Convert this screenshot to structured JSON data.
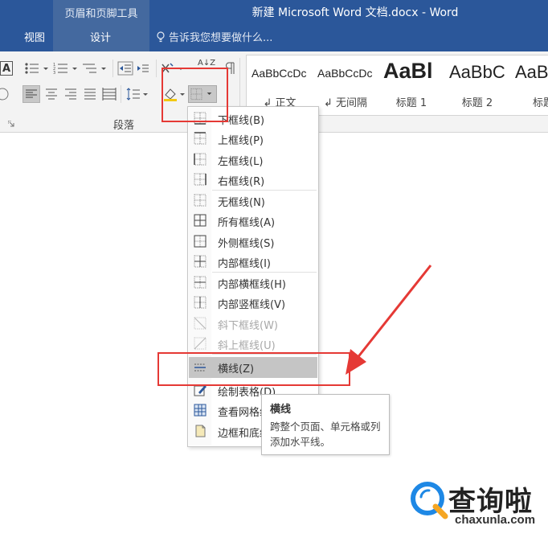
{
  "titlebar": {
    "context_group": "页眉和页脚工具",
    "doc_title": "新建 Microsoft Word 文档.docx - Word",
    "tabs": [
      {
        "label": "视图"
      },
      {
        "label": "设计"
      }
    ],
    "tell_me": "告诉我您想要做什么..."
  },
  "ribbon": {
    "group_label": "段落",
    "font_box_label": "A",
    "sort_label": "A↓Z",
    "styles": [
      {
        "sample": "AaBbCcDc",
        "name": "↲ 正文"
      },
      {
        "sample": "AaBbCcDc",
        "name": "↲ 无间隔"
      },
      {
        "sample": "AaBl",
        "name": "标题 1"
      },
      {
        "sample": "AaBbC",
        "name": "标题 2"
      },
      {
        "sample": "AaB",
        "name": "标题"
      }
    ]
  },
  "menu": {
    "items": [
      {
        "label": "下框线(B)",
        "icon": "border-bottom-icon",
        "disabled": false
      },
      {
        "label": "上框线(P)",
        "icon": "border-top-icon",
        "disabled": false
      },
      {
        "label": "左框线(L)",
        "icon": "border-left-icon",
        "disabled": false
      },
      {
        "label": "右框线(R)",
        "icon": "border-right-icon",
        "disabled": false
      },
      {
        "label": "无框线(N)",
        "icon": "no-border-icon",
        "disabled": false
      },
      {
        "label": "所有框线(A)",
        "icon": "all-borders-icon",
        "disabled": false
      },
      {
        "label": "外侧框线(S)",
        "icon": "outside-borders-icon",
        "disabled": false
      },
      {
        "label": "内部框线(I)",
        "icon": "inside-borders-icon",
        "disabled": false
      },
      {
        "label": "内部横框线(H)",
        "icon": "inside-horizontal-border-icon",
        "disabled": false
      },
      {
        "label": "内部竖框线(V)",
        "icon": "inside-vertical-border-icon",
        "disabled": false
      },
      {
        "label": "斜下框线(W)",
        "icon": "diagonal-down-border-icon",
        "disabled": true
      },
      {
        "label": "斜上框线(U)",
        "icon": "diagonal-up-border-icon",
        "disabled": true
      },
      {
        "label": "横线(Z)",
        "icon": "horizontal-line-icon",
        "disabled": false,
        "highlighted": true
      },
      {
        "label": "绘制表格(D)",
        "icon": "draw-table-icon",
        "disabled": false
      },
      {
        "label": "查看网格线(G)",
        "icon": "view-gridlines-icon",
        "disabled": false
      },
      {
        "label": "边框和底纹(O)...",
        "icon": "borders-shading-icon",
        "disabled": false
      }
    ]
  },
  "tooltip": {
    "title": "横线",
    "body": "跨整个页面、单元格或列添加水平线。"
  },
  "watermark": {
    "brand": "查询啦",
    "url": "chaxunla.com"
  },
  "colors": {
    "title_bar": "#2b579a",
    "ribbon": "#f3f3f3",
    "annotation": "#e53935",
    "menu_highlight": "#c5c5c5",
    "watermark_blue": "#1e88e5"
  }
}
